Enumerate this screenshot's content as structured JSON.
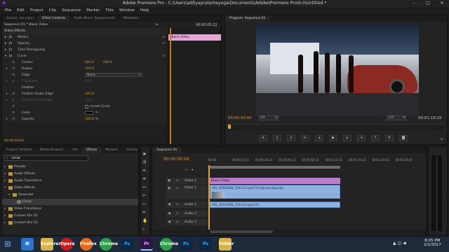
{
  "window": {
    "title": "Adobe Premiere Pro - C:\\Users\\adityapratamayoga\\Documents\\Adobe\\Premiere Pro\\6.0\\Untitled *",
    "app_icon": "Pr"
  },
  "menu": [
    "File",
    "Edit",
    "Project",
    "Clip",
    "Sequence",
    "Marker",
    "Title",
    "Window",
    "Help"
  ],
  "top_left_tabs": [
    "Source: (no clips)",
    "Effect Controls",
    "Audio Mixer: Sequence 01",
    "Metadata"
  ],
  "effect_controls": {
    "breadcrumb": "Sequence 01 * Black Video",
    "timecode": "00:00:05:22",
    "clip_bar_label": "Black Video",
    "section": "Video Effects",
    "rows": [
      {
        "label": "Motion",
        "kind": "fx"
      },
      {
        "label": "Opacity",
        "kind": "fx"
      },
      {
        "label": "Time Remapping",
        "kind": "fx"
      },
      {
        "label": "Circle",
        "kind": "fx"
      },
      {
        "label": "Center",
        "kind": "prop",
        "v1": "640.0",
        "v2": "540.0"
      },
      {
        "label": "Radius",
        "kind": "prop",
        "v1": "740.0"
      },
      {
        "label": "Edge",
        "kind": "prop",
        "v1": "None"
      },
      {
        "label": "Thickness",
        "kind": "dim",
        "v1": "10.0"
      },
      {
        "label": "Feather",
        "kind": "group"
      },
      {
        "label": "Feather Outer Edge",
        "kind": "prop",
        "v1": "420.0"
      },
      {
        "label": "Feather Inner Edge",
        "kind": "dim",
        "v1": "10.0"
      },
      {
        "label": "",
        "kind": "check",
        "v1": "Invert Circle"
      },
      {
        "label": "Color",
        "kind": "color"
      },
      {
        "label": "Opacity",
        "kind": "prop",
        "v1": "100.0 %"
      }
    ],
    "bottom_timecode": "00:00:00:00"
  },
  "program": {
    "tab": "Program: Sequence 01",
    "timecode_left": "00:00:00:00",
    "fit": "Fit",
    "resolution": "1/2",
    "timecode_right": "00:01:19:15"
  },
  "project_tabs": [
    "Project: Untitled",
    "Media Browser",
    "Info",
    "Effects",
    "Markers",
    "History"
  ],
  "effects_panel": {
    "search_value": "circle",
    "items": [
      {
        "label": "Presets",
        "indent": 0,
        "open": false,
        "kind": "folder"
      },
      {
        "label": "Audio Effects",
        "indent": 0,
        "open": false,
        "kind": "folder"
      },
      {
        "label": "Audio Transitions",
        "indent": 0,
        "open": false,
        "kind": "folder"
      },
      {
        "label": "Video Effects",
        "indent": 0,
        "open": true,
        "kind": "folder"
      },
      {
        "label": "Generate",
        "indent": 1,
        "open": true,
        "kind": "folder"
      },
      {
        "label": "Circle",
        "indent": 2,
        "open": false,
        "kind": "item"
      },
      {
        "label": "Video Transitions",
        "indent": 0,
        "open": false,
        "kind": "folder"
      },
      {
        "label": "Custom Bin 01",
        "indent": 0,
        "open": false,
        "kind": "folder"
      },
      {
        "label": "Custom Bin 01",
        "indent": 0,
        "open": false,
        "kind": "folder"
      }
    ]
  },
  "timeline": {
    "tab": "Sequence 01",
    "timecode": "00:00:00:00",
    "ruler": [
      "00:00",
      "00:00:14:23",
      "00:00:29:23",
      "00:00:44:22",
      "00:00:59:22",
      "00:01:14:22",
      "00:01:29:21",
      "00:01:44:21",
      "00:01:59:21"
    ],
    "tracks": {
      "v2": "Video 2",
      "v1": "Video 1",
      "a1": "Audio 1",
      "a2": "Audio 2",
      "a3": "Audio 3"
    },
    "clip_black": "Black Video",
    "clip_video": "VID_20161008_154113.mp4 [V]  Opacity:Opacity",
    "clip_audio": "VID_20161008_154113.mp4 [A]"
  },
  "taskbar": {
    "time": "8:05 PM",
    "date": "2/2/2017",
    "apps": [
      "IE",
      "Explorer",
      "Opera",
      "Firefox",
      "Chrome",
      "Ps",
      "Pr",
      "Chrome",
      "Ps",
      "Ps",
      "Folder"
    ]
  }
}
